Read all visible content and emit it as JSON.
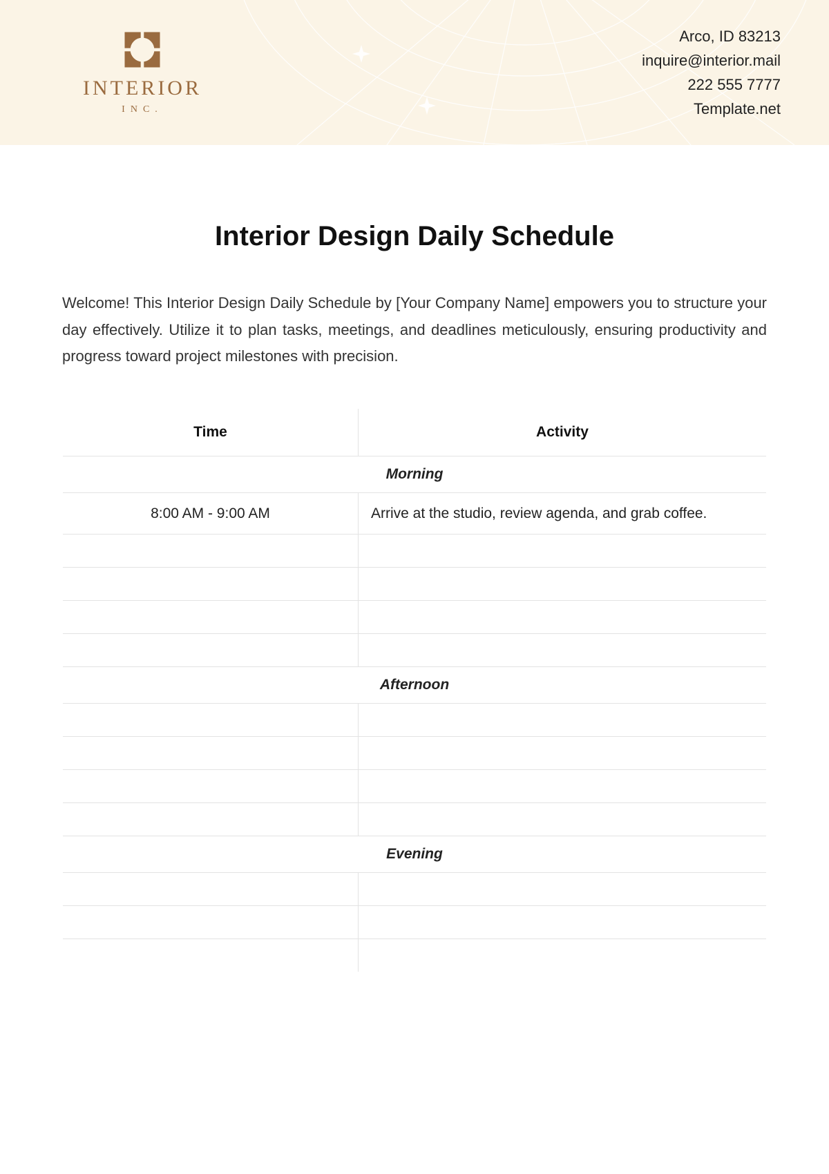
{
  "header": {
    "logo_word": "INTERIOR",
    "logo_sub": "INC.",
    "contact": {
      "address": "Arco, ID 83213",
      "email": "inquire@interior.mail",
      "phone": "222 555 7777",
      "site": "Template.net"
    }
  },
  "page": {
    "title": "Interior Design Daily Schedule",
    "intro": "Welcome! This Interior Design Daily Schedule by [Your Company Name] empowers you to structure your day effectively. Utilize it to plan tasks, meetings, and deadlines meticulously, ensuring productivity and progress toward project milestones with precision."
  },
  "table": {
    "headers": {
      "time": "Time",
      "activity": "Activity"
    },
    "sections": {
      "morning": "Morning",
      "afternoon": "Afternoon",
      "evening": "Evening"
    },
    "rows": {
      "morning": [
        {
          "time": "8:00 AM - 9:00 AM",
          "activity": "Arrive at the studio, review agenda, and grab coffee."
        },
        {
          "time": "",
          "activity": ""
        },
        {
          "time": "",
          "activity": ""
        },
        {
          "time": "",
          "activity": ""
        },
        {
          "time": "",
          "activity": ""
        }
      ],
      "afternoon": [
        {
          "time": "",
          "activity": ""
        },
        {
          "time": "",
          "activity": ""
        },
        {
          "time": "",
          "activity": ""
        },
        {
          "time": "",
          "activity": ""
        }
      ],
      "evening": [
        {
          "time": "",
          "activity": ""
        },
        {
          "time": "",
          "activity": ""
        },
        {
          "time": "",
          "activity": ""
        }
      ]
    }
  }
}
